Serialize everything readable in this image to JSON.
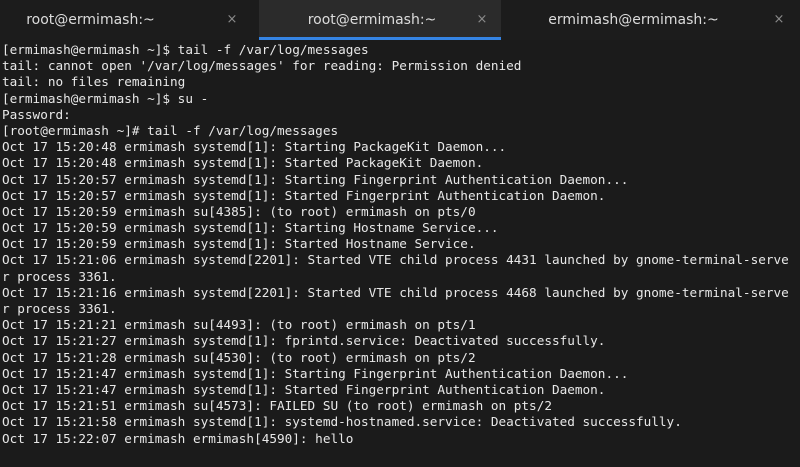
{
  "tabs": [
    {
      "title": "root@ermimash:~",
      "close": "×",
      "active": false
    },
    {
      "title": "root@ermimash:~",
      "close": "×",
      "active": true
    },
    {
      "title": "ermimash@ermimash:~",
      "close": "×",
      "active": false
    }
  ],
  "colors": {
    "background": "#1b1b1b",
    "active_tab": "#2b2b2b",
    "accent": "#3584e4",
    "text": "#e8e8e8"
  },
  "terminal": {
    "lines": [
      "[ermimash@ermimash ~]$ tail -f /var/log/messages",
      "tail: cannot open '/var/log/messages' for reading: Permission denied",
      "tail: no files remaining",
      "[ermimash@ermimash ~]$ su -",
      "Password:",
      "[root@ermimash ~]# tail -f /var/log/messages",
      "Oct 17 15:20:48 ermimash systemd[1]: Starting PackageKit Daemon...",
      "Oct 17 15:20:48 ermimash systemd[1]: Started PackageKit Daemon.",
      "Oct 17 15:20:57 ermimash systemd[1]: Starting Fingerprint Authentication Daemon...",
      "Oct 17 15:20:57 ermimash systemd[1]: Started Fingerprint Authentication Daemon.",
      "Oct 17 15:20:59 ermimash su[4385]: (to root) ermimash on pts/0",
      "Oct 17 15:20:59 ermimash systemd[1]: Starting Hostname Service...",
      "Oct 17 15:20:59 ermimash systemd[1]: Started Hostname Service.",
      "Oct 17 15:21:06 ermimash systemd[2201]: Started VTE child process 4431 launched by gnome-terminal-serve",
      "r process 3361.",
      "Oct 17 15:21:16 ermimash systemd[2201]: Started VTE child process 4468 launched by gnome-terminal-serve",
      "r process 3361.",
      "Oct 17 15:21:21 ermimash su[4493]: (to root) ermimash on pts/1",
      "Oct 17 15:21:27 ermimash systemd[1]: fprintd.service: Deactivated successfully.",
      "Oct 17 15:21:28 ermimash su[4530]: (to root) ermimash on pts/2",
      "Oct 17 15:21:47 ermimash systemd[1]: Starting Fingerprint Authentication Daemon...",
      "Oct 17 15:21:47 ermimash systemd[1]: Started Fingerprint Authentication Daemon.",
      "Oct 17 15:21:51 ermimash su[4573]: FAILED SU (to root) ermimash on pts/2",
      "Oct 17 15:21:58 ermimash systemd[1]: systemd-hostnamed.service: Deactivated successfully.",
      "Oct 17 15:22:07 ermimash ermimash[4590]: hello"
    ]
  }
}
